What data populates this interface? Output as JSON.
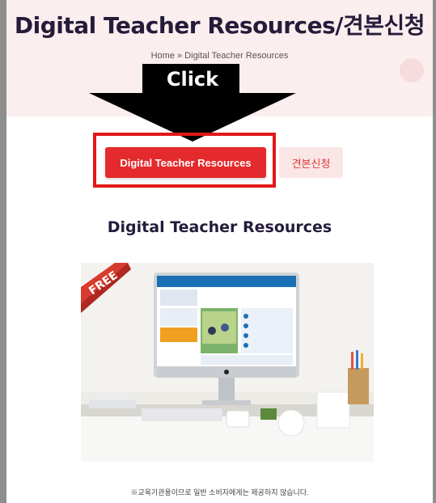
{
  "page": {
    "title": "Digital Teacher Resources/견본신청",
    "breadcrumb": "Home » Digital Teacher Resources",
    "section_title": "Digital Teacher Resources",
    "footnote": "※교육기관용이므로 일반 소비자에게는 제공하지 않습니다."
  },
  "annotation": {
    "arrow_label": "Click"
  },
  "buttons": {
    "primary_label": "Digital Teacher Resources",
    "secondary_label": "견본신청"
  },
  "product_image": {
    "badge": "FREE"
  },
  "colors": {
    "accent_red": "#e42a2c",
    "title_navy": "#241c3a",
    "hero_bg": "#fbeeee"
  }
}
